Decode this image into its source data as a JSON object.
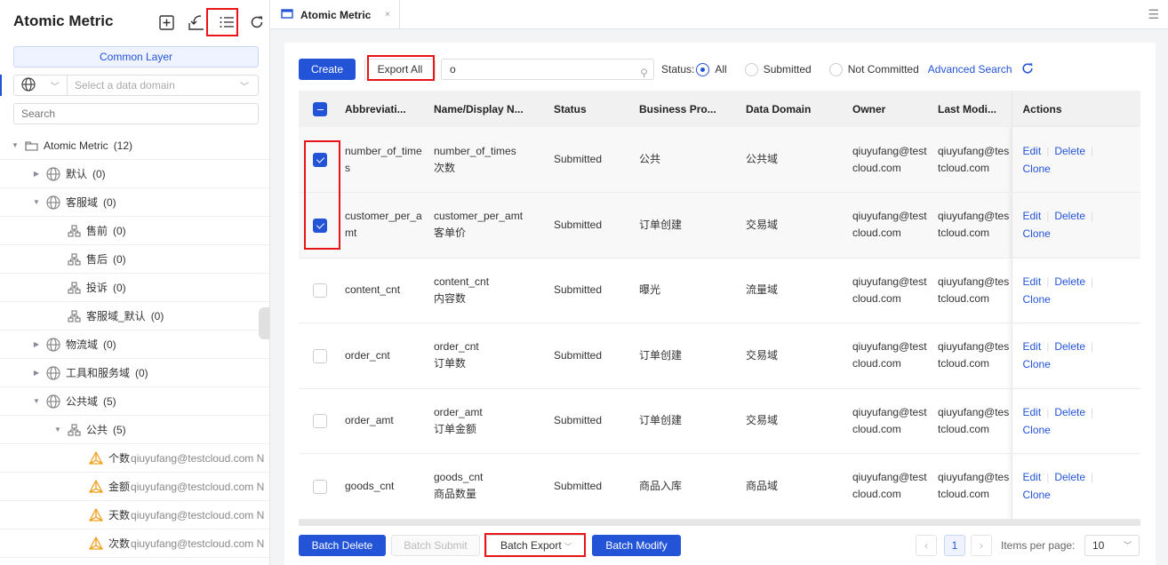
{
  "sidebar": {
    "title": "Atomic Metric",
    "layer_button": "Common Layer",
    "domain_placeholder": "Select a data domain",
    "search_placeholder": "Search",
    "tree": [
      {
        "label": "Atomic Metric",
        "count": "(12)",
        "level": 0,
        "type": "folder",
        "expanded": true
      },
      {
        "label": "默认",
        "count": "(0)",
        "level": 1,
        "type": "domain",
        "expanded": false
      },
      {
        "label": "客服域",
        "count": "(0)",
        "level": 1,
        "type": "domain",
        "expanded": true
      },
      {
        "label": "售前",
        "count": "(0)",
        "level": 2,
        "type": "process"
      },
      {
        "label": "售后",
        "count": "(0)",
        "level": 2,
        "type": "process"
      },
      {
        "label": "投诉",
        "count": "(0)",
        "level": 2,
        "type": "process"
      },
      {
        "label": "客服域_默认",
        "count": "(0)",
        "level": 2,
        "type": "process"
      },
      {
        "label": "物流域",
        "count": "(0)",
        "level": 1,
        "type": "domain",
        "expanded": false
      },
      {
        "label": "工具和服务域",
        "count": "(0)",
        "level": 1,
        "type": "domain",
        "expanded": false
      },
      {
        "label": "公共域",
        "count": "(5)",
        "level": 1,
        "type": "domain",
        "expanded": true
      },
      {
        "label": "公共",
        "count": "(5)",
        "level": 2,
        "type": "process",
        "expanded": true
      },
      {
        "label": "个数",
        "count": "qiuyufang@testcloud.com N",
        "level": 3,
        "type": "metric"
      },
      {
        "label": "金额",
        "count": "qiuyufang@testcloud.com N",
        "level": 3,
        "type": "metric"
      },
      {
        "label": "天数",
        "count": "qiuyufang@testcloud.com N",
        "level": 3,
        "type": "metric"
      },
      {
        "label": "次数",
        "count": "qiuyufang@testcloud.com N",
        "level": 3,
        "type": "metric"
      }
    ]
  },
  "tab": {
    "label": "Atomic Metric",
    "close": "×"
  },
  "toolbar": {
    "create": "Create",
    "export_all": "Export All",
    "search_value": "o",
    "status_label": "Status:",
    "status_options": [
      "All",
      "Submitted",
      "Not Committed"
    ],
    "status_selected": "All",
    "advanced_search": "Advanced Search"
  },
  "table": {
    "columns": [
      "Abbreviati...",
      "Name/Display N...",
      "Status",
      "Business Pro...",
      "Data Domain",
      "Owner",
      "Last Modi...",
      "Actions"
    ],
    "rows": [
      {
        "checked": true,
        "abbr": "number_of_times",
        "name": "number_of_times",
        "display": "次数",
        "status": "Submitted",
        "process": "公共",
        "domain": "公共域",
        "owner": "qiuyufang@testcloud.com",
        "modifier": "qiuyufang@testcloud.com"
      },
      {
        "checked": true,
        "abbr": "customer_per_amt",
        "name": "customer_per_amt",
        "display": "客单价",
        "status": "Submitted",
        "process": "订单创建",
        "domain": "交易域",
        "owner": "qiuyufang@testcloud.com",
        "modifier": "qiuyufang@testcloud.com"
      },
      {
        "checked": false,
        "abbr": "content_cnt",
        "name": "content_cnt",
        "display": "内容数",
        "status": "Submitted",
        "process": "曝光",
        "domain": "流量域",
        "owner": "qiuyufang@testcloud.com",
        "modifier": "qiuyufang@testcloud.com"
      },
      {
        "checked": false,
        "abbr": "order_cnt",
        "name": "order_cnt",
        "display": "订单数",
        "status": "Submitted",
        "process": "订单创建",
        "domain": "交易域",
        "owner": "qiuyufang@testcloud.com",
        "modifier": "qiuyufang@testcloud.com"
      },
      {
        "checked": false,
        "abbr": "order_amt",
        "name": "order_amt",
        "display": "订单金额",
        "status": "Submitted",
        "process": "订单创建",
        "domain": "交易域",
        "owner": "qiuyufang@testcloud.com",
        "modifier": "qiuyufang@testcloud.com"
      },
      {
        "checked": false,
        "abbr": "goods_cnt",
        "name": "goods_cnt",
        "display": "商品数量",
        "status": "Submitted",
        "process": "商品入库",
        "domain": "商品域",
        "owner": "qiuyufang@testcloud.com",
        "modifier": "qiuyufang@testcloud.com"
      }
    ],
    "actions": {
      "edit": "Edit",
      "delete": "Delete",
      "clone": "Clone"
    }
  },
  "footer": {
    "batch_delete": "Batch Delete",
    "batch_submit": "Batch Submit",
    "batch_export": "Batch Export",
    "batch_modify": "Batch Modify",
    "current_page": "1",
    "items_per_page_label": "Items per page:",
    "items_per_page": "10"
  },
  "colors": {
    "accent": "#2354d8",
    "highlight": "#e8141a",
    "warning": "#f0a020"
  }
}
